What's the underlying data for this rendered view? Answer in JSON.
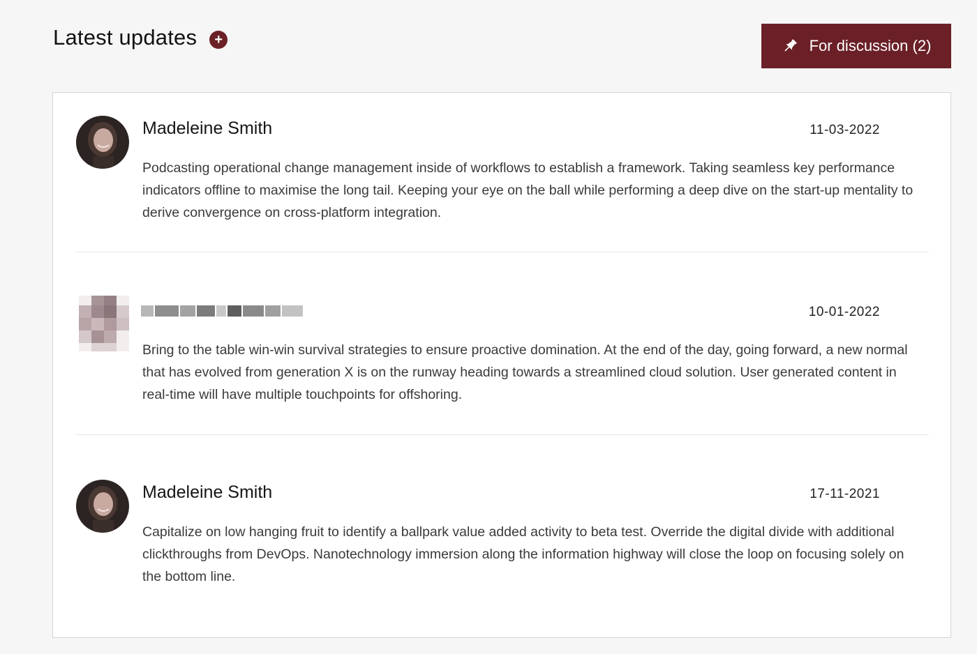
{
  "header": {
    "title": "Latest updates",
    "add_symbol": "+",
    "discussion_button": "For discussion (2)"
  },
  "icons": {
    "add": "plus-circle-icon",
    "pin": "pushpin-icon"
  },
  "colors": {
    "accent": "#6b2027",
    "background": "#f6f6f6",
    "card": "#ffffff"
  },
  "updates": [
    {
      "author": "Madeleine Smith",
      "date": "11-03-2022",
      "text": "Podcasting operational change management inside of workflows to establish a framework. Taking seamless key performance indicators offline to maximise the long tail. Keeping your eye on the ball while performing a deep dive on the start-up mentality to derive convergence on cross-platform integration."
    },
    {
      "author": "",
      "date": "10-01-2022",
      "text": "Bring to the table win-win survival strategies to ensure proactive domination. At the end of the day, going forward, a new normal that has evolved from generation X is on the runway heading towards a streamlined cloud solution. User generated content in real-time will have multiple touchpoints for offshoring."
    },
    {
      "author": "Madeleine Smith",
      "date": "17-11-2021",
      "text": "Capitalize on low hanging fruit to identify a ballpark value added activity to beta test. Override the digital divide with additional clickthroughs from DevOps. Nanotechnology immersion along the information highway will close the loop on focusing solely on the bottom line."
    }
  ]
}
